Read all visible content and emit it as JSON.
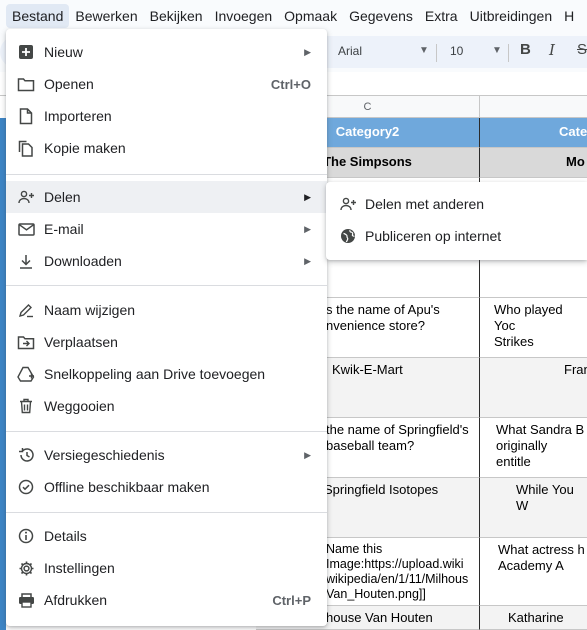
{
  "menubar": {
    "items": [
      "Bestand",
      "Bewerken",
      "Bekijken",
      "Invoegen",
      "Opmaak",
      "Gegevens",
      "Extra",
      "Uitbreidingen",
      "H"
    ]
  },
  "toolbar": {
    "font": "Arial",
    "font_size": "10",
    "bold": "B",
    "italic": "I",
    "strike": "S"
  },
  "sheet": {
    "col_c": "C",
    "header_col2": "Category2",
    "header_col3": "Cate",
    "sub_col2": "The Simpsons",
    "sub_col3": "Mo",
    "r1_c2": "s the name of Apu's\nnvenience store?",
    "r1_c3": "Who played Yoc\nStrikes",
    "r2_c2": "Kwik-E-Mart",
    "r2_c3": "Fran",
    "r3_c2": "the name of Springfield's\nbaseball team?",
    "r3_c3": "What Sandra B\noriginally entitle",
    "r4_c2": "Springfield Isotopes",
    "r4_c3": "While You W",
    "r5_c2": "Name this\nImage:https://upload.wiki\nwikipedia/en/1/11/Milhous\nVan_Houten.png]]",
    "r5_c3": "What actress h\nAcademy A",
    "r6_c2": "house Van Houten",
    "r6_c3": "Katharine"
  },
  "file_menu": {
    "new": "Nieuw",
    "open": "Openen",
    "open_shortcut": "Ctrl+O",
    "import": "Importeren",
    "copy": "Kopie maken",
    "share": "Delen",
    "email": "E-mail",
    "download": "Downloaden",
    "rename": "Naam wijzigen",
    "move": "Verplaatsen",
    "shortcut": "Snelkoppeling aan Drive toevoegen",
    "trash": "Weggooien",
    "history": "Versiegeschiedenis",
    "offline": "Offline beschikbaar maken",
    "details": "Details",
    "settings": "Instellingen",
    "print": "Afdrukken",
    "print_shortcut": "Ctrl+P"
  },
  "share_submenu": {
    "share_others": "Delen met anderen",
    "publish": "Publiceren op internet"
  },
  "colors": {
    "header_blue": "#6fa8dc",
    "menu_active": "#e1e9f4"
  }
}
